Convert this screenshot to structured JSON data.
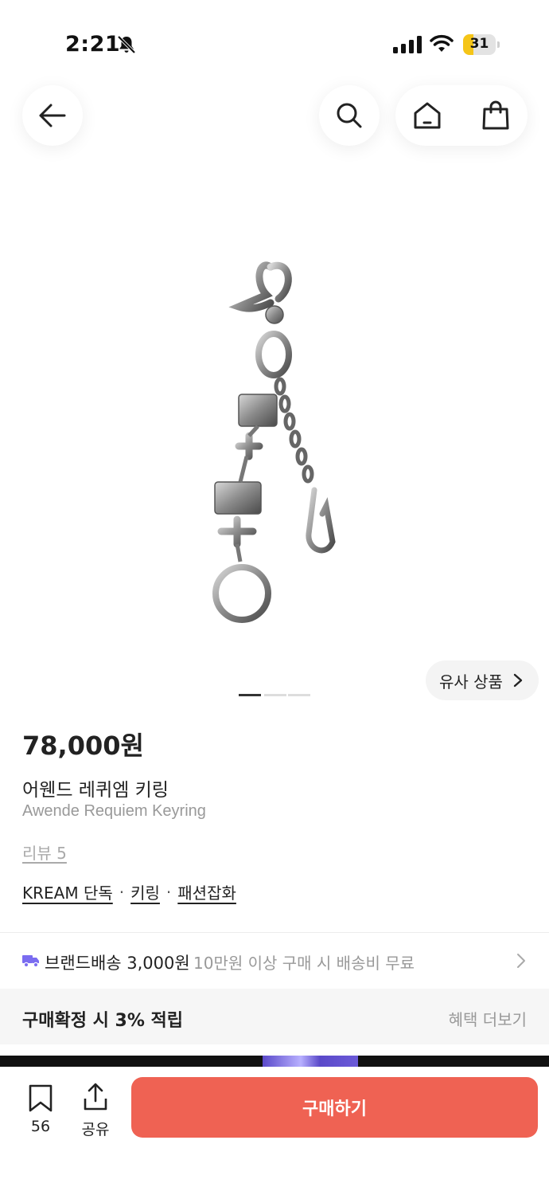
{
  "status_bar": {
    "time": "2:21",
    "battery": "31",
    "battery_level": 0.31,
    "icons": [
      "bell-slash-icon",
      "cellular-signal-icon",
      "wifi-icon",
      "battery-icon"
    ]
  },
  "nav": {
    "back_icon": "arrow-left-icon",
    "search_icon": "search-icon",
    "home_icon": "home-icon",
    "bag_icon": "shopping-bag-icon"
  },
  "gallery": {
    "image_alt": "keyring-product-image",
    "similar_label": "유사 상품",
    "page_count": 3,
    "active_page": 1
  },
  "product": {
    "price": "78,000원",
    "name_ko": "어웬드 레퀴엠 키링",
    "name_en": "Awende Requiem Keyring",
    "review": "리뷰 5",
    "tags": [
      "KREAM 단독",
      "키링",
      "패션잡화"
    ],
    "tag_separator": "·"
  },
  "shipping": {
    "icon": "truck-icon",
    "label": "브랜드배송 3,000원",
    "note": "10만원 이상 구매 시 배송비 무료"
  },
  "benefit": {
    "label": "구매확정 시 3% 적립",
    "more": "혜택 더보기"
  },
  "bottom_bar": {
    "save_count": "56",
    "share_label": "공유",
    "buy_label": "구매하기"
  },
  "colors": {
    "buy_button": "#ef6253",
    "truck_icon": "#7a6cf0",
    "battery_fill": "#f5c518"
  }
}
